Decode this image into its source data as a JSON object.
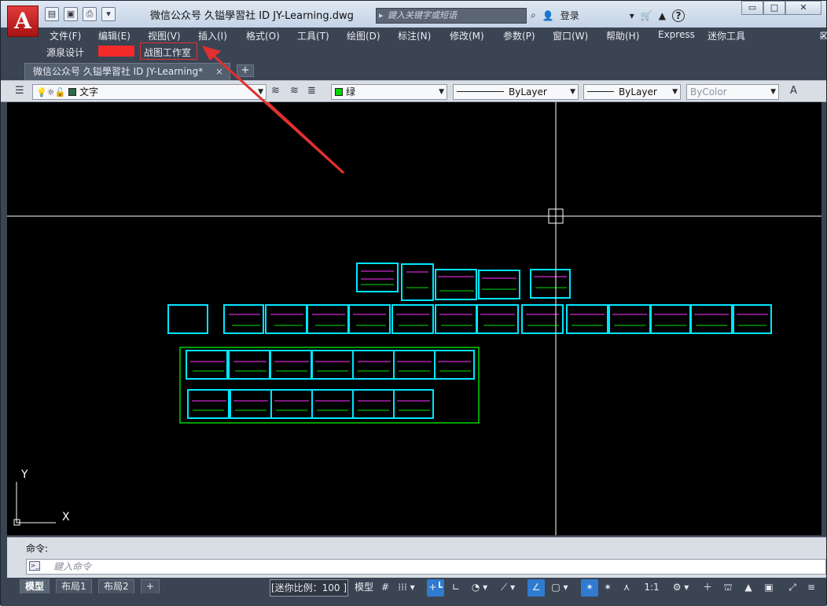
{
  "title_bar": {
    "logo": "A",
    "app_title": "微信公众号 久镒學習社 ID  JY-Learning.dwg",
    "search_placeholder": "鍵入关键字或短语",
    "login_label": "登录",
    "help_label": "?"
  },
  "window_controls": {
    "minimize": "▭",
    "maximize": "□",
    "close": "✕"
  },
  "menu": {
    "items": [
      "文件(F)",
      "编辑(E)",
      "视图(V)",
      "插入(I)",
      "格式(O)",
      "工具(T)",
      "绘图(D)",
      "标注(N)",
      "修改(M)",
      "参数(P)",
      "窗口(W)",
      "帮助(H)",
      "Express",
      "迷你工具"
    ]
  },
  "menu2": {
    "items": [
      "源泉设计",
      "战图工作室"
    ]
  },
  "doc_tab": {
    "label": "微信公众号 久镒學習社 ID  JY-Learning*",
    "close": "×",
    "add": "+"
  },
  "properties": {
    "layer": "文字",
    "color": "绿",
    "linetype": "ByLayer",
    "lineweight": "ByLayer",
    "plotstyle": "ByColor"
  },
  "canvas": {
    "background": "#000000",
    "ucs_x": "X",
    "ucs_y": "Y",
    "drawing_color": "#00e5ff",
    "frame_color": "#00d400"
  },
  "command": {
    "label": "命令:",
    "placeholder": "鍵入命令"
  },
  "status": {
    "layout_tabs": [
      "模型",
      "布局1",
      "布局2"
    ],
    "add": "+",
    "scale_label": "[迷你比例：100 ]",
    "model_label": "模型",
    "zoom_label": "1:1"
  },
  "colors": {
    "accent": "#2f7bd0",
    "chrome": "#3b4453",
    "highlight_red": "#e03030"
  }
}
